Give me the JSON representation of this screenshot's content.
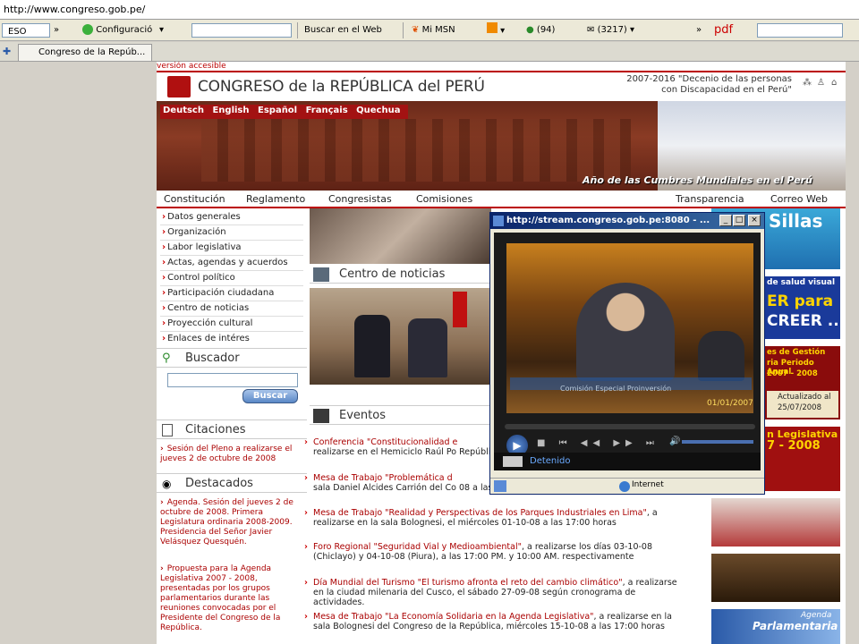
{
  "browser": {
    "address": "http://www.congreso.gob.pe/",
    "toolbar": {
      "dropdown1": "ESO",
      "config": "Configuració",
      "search_web": "Buscar en el Web",
      "msn": "Mi MSN",
      "mail_count": "(94)",
      "inbox_count": "(3217)",
      "pdf": "pdf"
    },
    "tab_title": "Congreso de la Repúb..."
  },
  "site": {
    "version_accesible": "versión accesible",
    "title": "CONGRESO de la REPÚBLICA del PERÚ",
    "decenio_line1": "2007-2016 \"Decenio de las personas",
    "decenio_line2": "con Discapacidad en el Perú\"",
    "languages": [
      "Deutsch",
      "English",
      "Español",
      "Français",
      "Quechua"
    ],
    "banner_caption": "Año de las Cumbres Mundiales en el Perú",
    "main_nav": [
      "Constitución",
      "Reglamento",
      "Congresistas",
      "Comisiones",
      "Transparencia",
      "Correo Web"
    ],
    "left_menu": [
      "Datos generales",
      "Organización",
      "Labor legislativa",
      "Actas, agendas y acuerdos",
      "Control político",
      "Participación ciudadana",
      "Centro de noticias",
      "Proyección cultural",
      "Enlaces de intéres"
    ],
    "buscador": {
      "title": "Buscador",
      "button": "Buscar"
    },
    "citaciones": {
      "title": "Citaciones",
      "items": [
        "Sesión del Pleno a realizarse el jueves 2 de octubre de 2008"
      ]
    },
    "destacados": {
      "title": "Destacados",
      "items": [
        "Agenda. Sesión del jueves 2 de octubre de 2008. Primera Legislatura ordinaria 2008-2009. Presidencia del Señor Javier Velásquez Quesquén.",
        "Propuesta para la Agenda Legislativa 2007 - 2008, presentadas por los grupos parlamentarios durante las reuniones convocadas por el Presidente del Congreso de la República."
      ]
    },
    "centro_noticias": "Centro de noticias",
    "eventos": {
      "title": "Eventos",
      "items": [
        {
          "title": "Conferencia \"Constitucionalidad e",
          "body": "realizarse en el Hemiciclo Raúl Po República, el miércoles 01-10-08"
        },
        {
          "title": "Mesa de Trabajo \"Problemática d",
          "body": "sala Daniel Alcides Carrión del Co 08 a las 15:00 horas"
        },
        {
          "title": "Mesa de Trabajo \"Realidad y Perspectivas de los Parques Industriales en Lima\"",
          "body": ", a realizarse en la sala Bolognesi, el miércoles 01-10-08 a las 17:00 horas"
        },
        {
          "title": "Foro Regional \"Seguridad Vial y Medioambiental\"",
          "body": ", a realizarse los días 03-10-08 (Chiclayo) y 04-10-08 (Piura), a las 17:00 PM. y 10:00 AM. respectivamente"
        },
        {
          "title": "Día Mundial del Turismo \"El turismo afronta el reto del cambio climático\"",
          "body": ", a realizarse en la ciudad milenaria del Cusco, el sábado 27-09-08 según cronograma de actividades."
        },
        {
          "title": "Mesa de Trabajo \"La Economía Solidaria en la Agenda Legislativa\"",
          "body": ", a realizarse en la sala Bolognesi del Congreso de la República, miércoles 15-10-08 a las 17:00 horas"
        }
      ]
    },
    "right_ads": {
      "ad1": "Sillas",
      "ad2_line1": "de salud visual",
      "ad2_line2": "ER para",
      "ad2_line3": "CREER ..",
      "ad3_line1": "es de Gestión",
      "ad3_line2": "ria Periodo Anual",
      "ad3_line3": "2007 - 2008",
      "ad3_line4": "Actualizado al",
      "ad3_line5": "25/07/2008",
      "ad4_line1": "n Legislativa",
      "ad4_line2": "7 - 2008",
      "ad5_line1": "Agenda",
      "ad5_line2": "Parlamentaria"
    }
  },
  "popup": {
    "title": "http://stream.congreso.gob.pe:8080 - ...",
    "video_caption": "Comisión Especial Proinversión",
    "video_date": "01/01/2007",
    "player_status": "Detenido",
    "zone": "Internet"
  },
  "colors": {
    "accent_red": "#b00000",
    "window_title": "#0a246a"
  }
}
